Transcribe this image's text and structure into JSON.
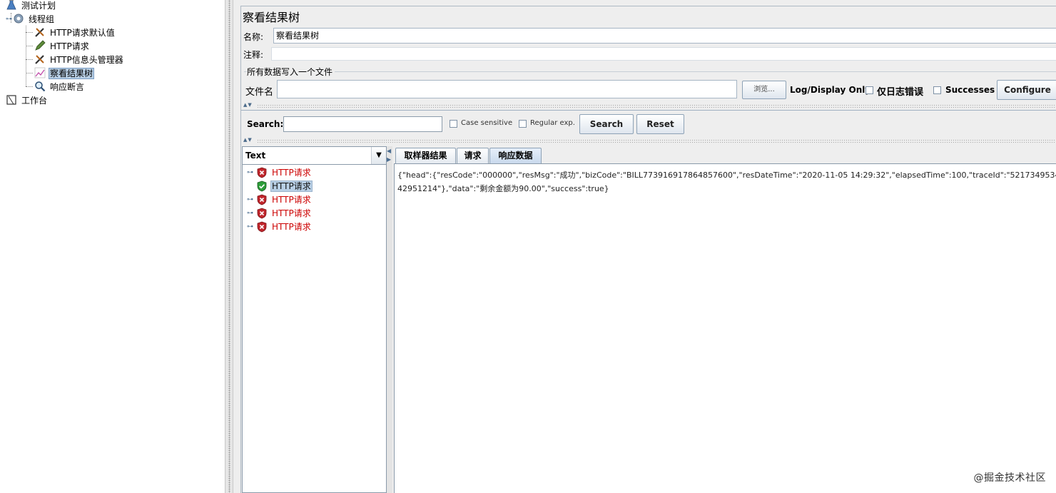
{
  "tree": {
    "items": [
      {
        "label": "测试计划",
        "icon": "flask-icon"
      },
      {
        "label": "线程组",
        "icon": "gear-icon"
      },
      {
        "label": "HTTP请求默认值",
        "icon": "wrench-icon"
      },
      {
        "label": "HTTP请求",
        "icon": "pen-icon"
      },
      {
        "label": "HTTP信息头管理器",
        "icon": "wrench-icon"
      },
      {
        "label": "察看结果树",
        "icon": "chart-icon"
      },
      {
        "label": "响应断言",
        "icon": "magnifier-icon"
      },
      {
        "label": "工作台",
        "icon": "workbench-icon"
      }
    ]
  },
  "panel": {
    "title": "察看结果树",
    "name_label": "名称:",
    "name_value": "察看结果树",
    "comment_label": "注释:",
    "comment_value": "",
    "group_title": "所有数据写入一个文件",
    "filename_label": "文件名",
    "filename_value": "",
    "browse_label": "浏览...",
    "log_display_label": "Log/Display Only:",
    "errors_label": "仅日志错误",
    "successes_label": "Successes",
    "configure_label": "Configure"
  },
  "search": {
    "label": "Search:",
    "value": "",
    "case_label": "Case sensitive",
    "regex_label": "Regular exp.",
    "search_button": "Search",
    "reset_button": "Reset"
  },
  "results": {
    "renderer": "Text",
    "items": [
      {
        "label": "HTTP请求",
        "status": "error"
      },
      {
        "label": "HTTP请求",
        "status": "success"
      },
      {
        "label": "HTTP请求",
        "status": "error"
      },
      {
        "label": "HTTP请求",
        "status": "error"
      },
      {
        "label": "HTTP请求",
        "status": "error"
      }
    ]
  },
  "tabs": [
    {
      "label": "取样器结果"
    },
    {
      "label": "请求"
    },
    {
      "label": "响应数据",
      "active": true
    }
  ],
  "response": {
    "text": "{\"head\":{\"resCode\":\"000000\",\"resMsg\":\"成功\",\"bizCode\":\"BILL773916917864857600\",\"resDateTime\":\"2020-11-05 14:29:32\",\"elapsedTime\":100,\"traceId\":\"521734953442951214\"},\"data\":\"剩余金额为90.00\",\"success\":true}"
  },
  "watermark": "@掘金技术社区",
  "colors": {
    "error_text": "#cc0000",
    "selection": "#b8cfe5",
    "success_shield": "#2e9e3a",
    "error_shield": "#c0262c"
  }
}
